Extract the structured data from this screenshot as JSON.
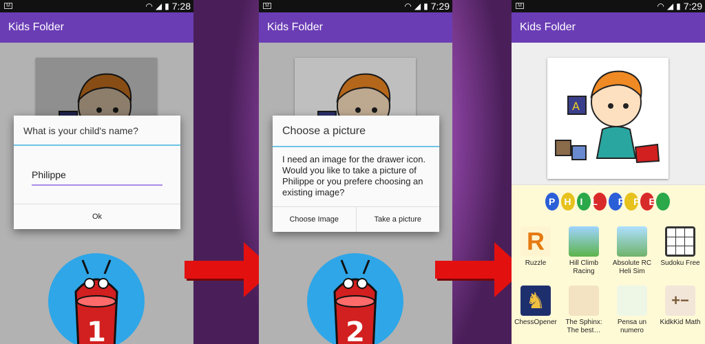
{
  "screens": [
    {
      "status": {
        "time": "7:28"
      },
      "app_title": "Kids Folder",
      "dialog": {
        "title": "What is your child's name?",
        "input_value": "Philippe",
        "ok_label": "Ok"
      },
      "step_number": "1"
    },
    {
      "status": {
        "time": "7:29"
      },
      "app_title": "Kids Folder",
      "dialog": {
        "title": "Choose a picture",
        "message": "I need an image for the drawer icon.\nWould you like to take a picture of Philippe or you prefere choosing an existing image?",
        "button_choose": "Choose Image",
        "button_take": "Take a picture"
      },
      "step_number": "2"
    },
    {
      "status": {
        "time": "7:29"
      },
      "app_title": "Kids Folder",
      "banner_name": "PHILIPPE",
      "apps": [
        {
          "label": "Ruzzle",
          "icon": "ruzzle-icon"
        },
        {
          "label": "Hill Climb Racing",
          "icon": "hill-climb-icon"
        },
        {
          "label": "Absolute RC Heli Sim",
          "icon": "heli-sim-icon"
        },
        {
          "label": "Sudoku Free",
          "icon": "sudoku-icon"
        },
        {
          "label": "ChessOpener",
          "icon": "chess-icon"
        },
        {
          "label": "The Sphinx: The best…",
          "icon": "sphinx-icon"
        },
        {
          "label": "Pensa un numero",
          "icon": "pensa-icon"
        },
        {
          "label": "KidkKid Math",
          "icon": "math-icon"
        }
      ]
    }
  ],
  "colors": {
    "appbar": "#6a3db5",
    "accent": "#6cc4e6",
    "arrow": "#e31010",
    "step_circle": "#2ea6e8"
  }
}
